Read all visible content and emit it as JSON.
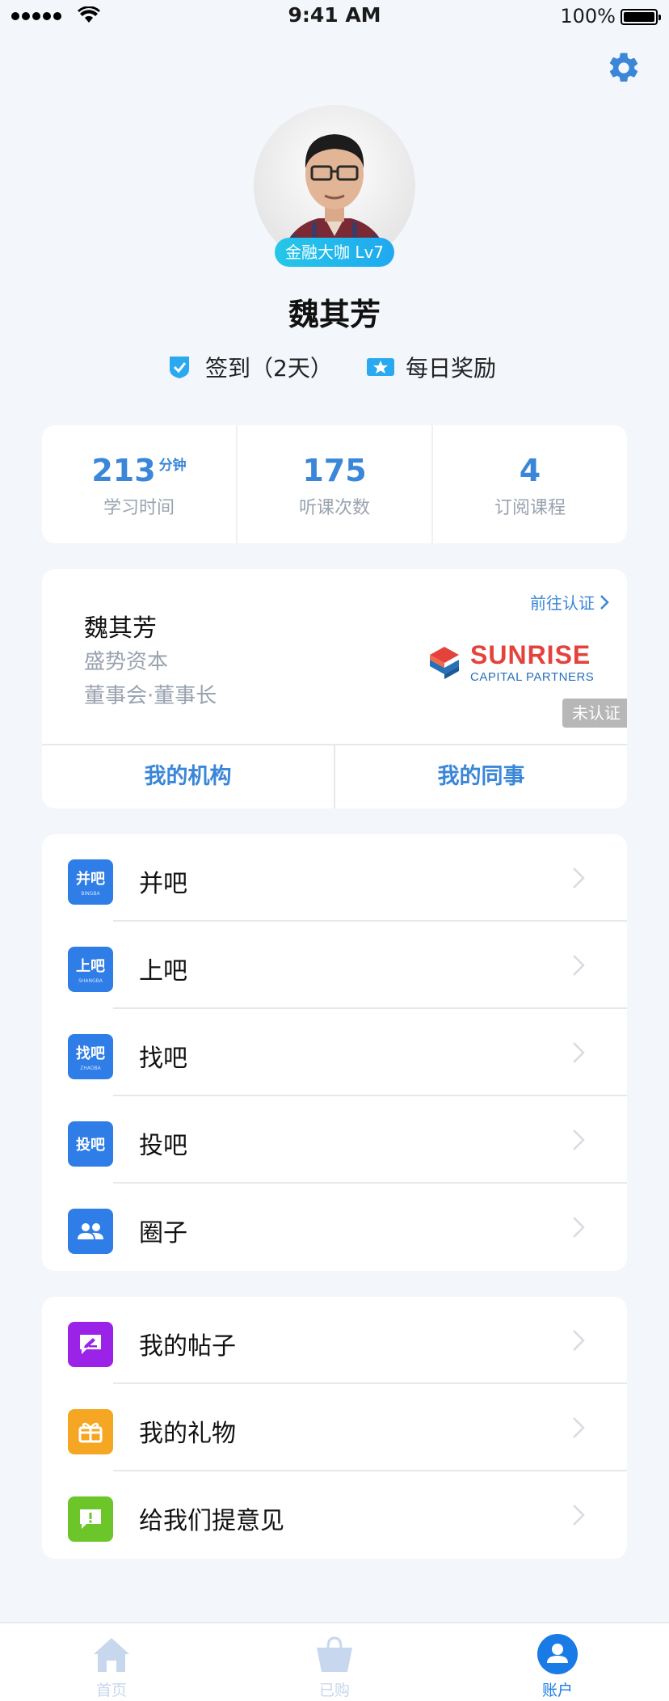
{
  "status_bar": {
    "time": "9:41 AM",
    "battery": "100%"
  },
  "profile": {
    "level_badge": "金融大咖 Lv7",
    "name": "魏其芳",
    "checkin": "签到（2天）",
    "daily_reward": "每日奖励"
  },
  "stats": [
    {
      "value": "213",
      "unit": "分钟",
      "label": "学习时间"
    },
    {
      "value": "175",
      "unit": "",
      "label": "听课次数"
    },
    {
      "value": "4",
      "unit": "",
      "label": "订阅课程"
    }
  ],
  "profile_card": {
    "verify_link": "前往认证",
    "name": "魏其芳",
    "company": "盛势资本",
    "role": "董事会·董事长",
    "logo_text": "SUNRISE",
    "logo_subtext": "CAPITAL PARTNERS",
    "status": "未认证",
    "actions": [
      "我的机构",
      "我的同事"
    ]
  },
  "menu_1": [
    {
      "label": "并吧",
      "icon": "bingba-icon",
      "icon_text": "并吧",
      "icon_sub": "BINGBA",
      "color": "#2f7de6"
    },
    {
      "label": "上吧",
      "icon": "shangba-icon",
      "icon_text": "上吧",
      "icon_sub": "SHANGBA",
      "color": "#2f7de6"
    },
    {
      "label": "找吧",
      "icon": "zhaoba-icon",
      "icon_text": "找吧",
      "icon_sub": "ZHAOBA",
      "color": "#2f7de6"
    },
    {
      "label": "投吧",
      "icon": "touba-icon",
      "icon_text": "投吧",
      "icon_sub": "",
      "color": "#2f7de6"
    },
    {
      "label": "圈子",
      "icon": "group-icon",
      "icon_text": "",
      "icon_sub": "",
      "color": "#2f7de6"
    }
  ],
  "menu_2": [
    {
      "label": "我的帖子",
      "icon": "post-icon",
      "color": "#9b23e8"
    },
    {
      "label": "我的礼物",
      "icon": "gift-icon",
      "color": "#f5a623"
    },
    {
      "label": "给我们提意见",
      "icon": "feedback-icon",
      "color": "#6cc62a"
    }
  ],
  "tabs": [
    {
      "label": "首页",
      "icon": "home-icon",
      "active": false
    },
    {
      "label": "已购",
      "icon": "basket-icon",
      "active": false
    },
    {
      "label": "账户",
      "icon": "account-icon",
      "active": true
    }
  ],
  "colors": {
    "accent": "#3a86d8",
    "active_tab": "#1a7be6",
    "logo_red": "#e4433d",
    "logo_blue": "#2870b8"
  }
}
